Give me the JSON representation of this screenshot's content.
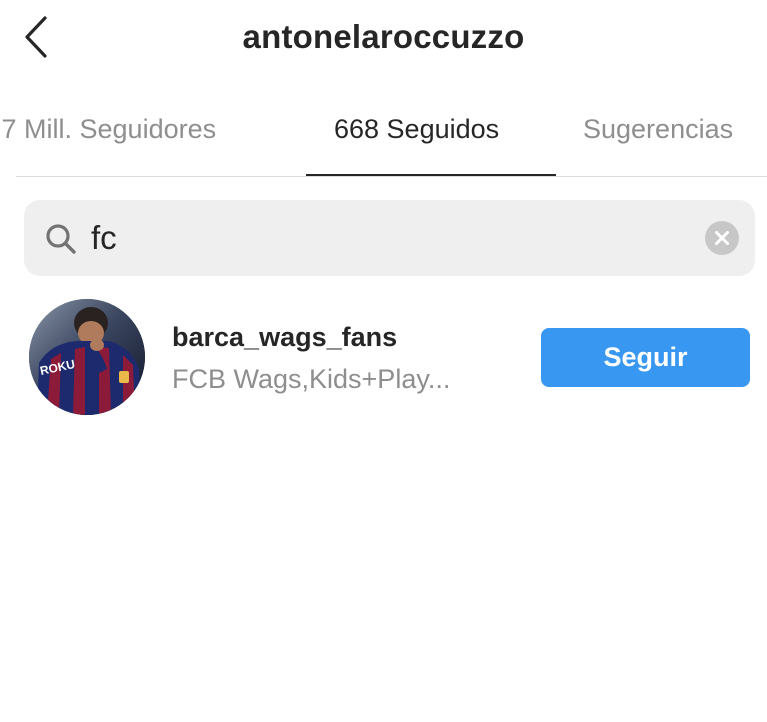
{
  "header": {
    "title": "antonelaroccuzzo",
    "back_icon": "chevron-left-icon"
  },
  "tabs": [
    {
      "label": ",7 Mill. Seguidores",
      "active": false
    },
    {
      "label": "668 Seguidos",
      "active": true
    },
    {
      "label": "Sugerencias",
      "active": false
    }
  ],
  "search": {
    "value": "fc",
    "icon": "search-icon",
    "clear_icon": "clear-icon"
  },
  "results": [
    {
      "username": "barca_wags_fans",
      "full_name": "FCB Wags,Kids+Play...",
      "follow_label": "Seguir",
      "avatar_text": "ROKU"
    }
  ],
  "colors": {
    "text_primary": "#262626",
    "text_secondary": "#8e8e8e",
    "divider": "#dbdbdb",
    "search_bg": "#efefef",
    "clear_bg": "#c7c7c7",
    "follow_button": "#3897f0",
    "follow_text": "#ffffff"
  }
}
